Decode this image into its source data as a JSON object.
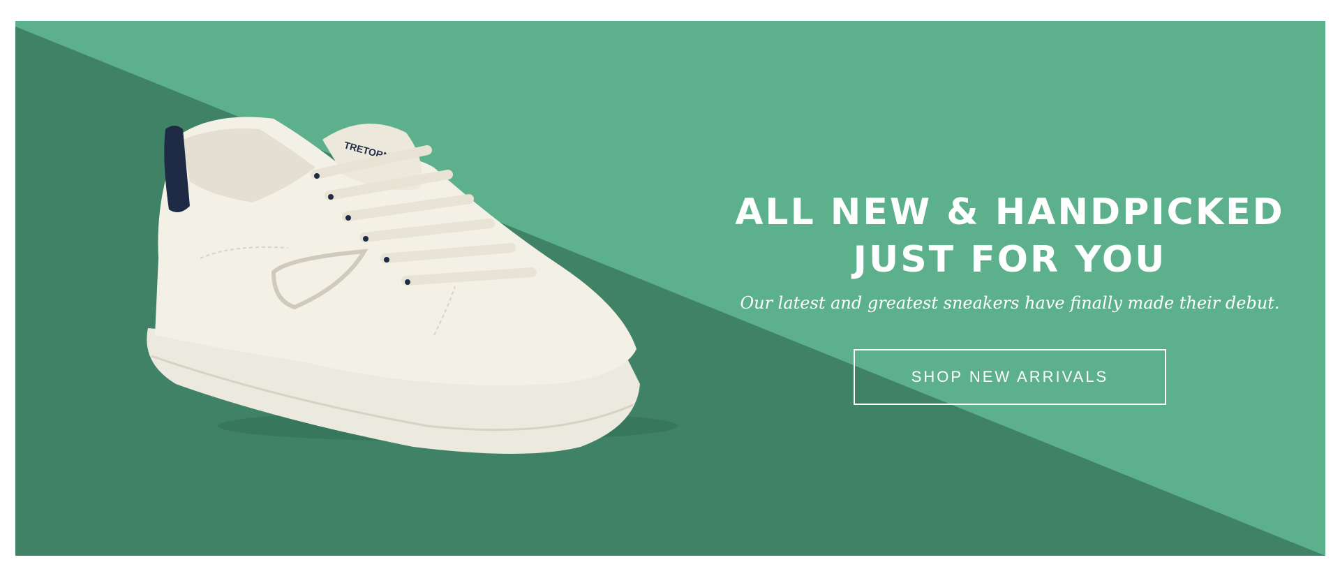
{
  "hero": {
    "headline_line1": "ALL NEW & HANDPICKED",
    "headline_line2": "JUST FOR YOU",
    "subheadline": "Our latest and greatest sneakers have finally made their debut.",
    "cta_label": "SHOP NEW ARRIVALS",
    "image_alt": "White leather sneaker with navy heel tab",
    "shoe_brand_text": "TRETORN"
  },
  "colors": {
    "light_green": "#5cb08c",
    "dark_green": "#3f8266",
    "shoe_white": "#f3f0e6",
    "heel_navy": "#1f2a44"
  }
}
